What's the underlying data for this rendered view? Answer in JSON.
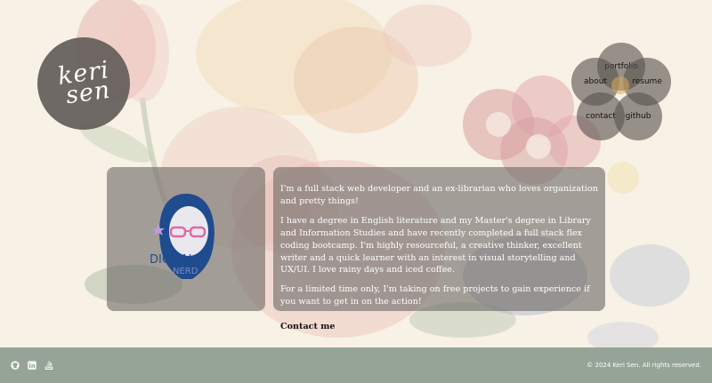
{
  "logo": {
    "line1": "keri",
    "line2": "sen"
  },
  "nav": {
    "portfolio": "portfolio",
    "about": "about",
    "resume": "resume",
    "contact": "contact",
    "github": "github"
  },
  "brand_image": {
    "line1": "DIGITAL",
    "line2": "NERD"
  },
  "about": {
    "p1": "I'm a full stack web developer and an ex-librarian who loves organization and pretty things!",
    "p2": "I have a degree in English literature and my Master's degree in Library and Information Studies and have recently completed a full stack flex coding bootcamp. I'm highly resourceful, a creative thinker, excellent writer and a quick learner with an interest in visual storytelling and UX/UI. I love rainy days and iced coffee.",
    "p3": "For a limited time only, I'm taking on free projects to gain experience if you want to get in on the action!",
    "contact_link": "Contact me"
  },
  "footer": {
    "icons": [
      "github-icon",
      "linkedin-icon",
      "stack-overflow-icon"
    ],
    "copyright": "© 2024 Keri Sen. All rights reserved."
  },
  "colors": {
    "footer_bg": "#96a497",
    "card_bg": "#6e6a67",
    "logo_bg": "#5f5a56",
    "page_bg": "#f5efe4"
  }
}
